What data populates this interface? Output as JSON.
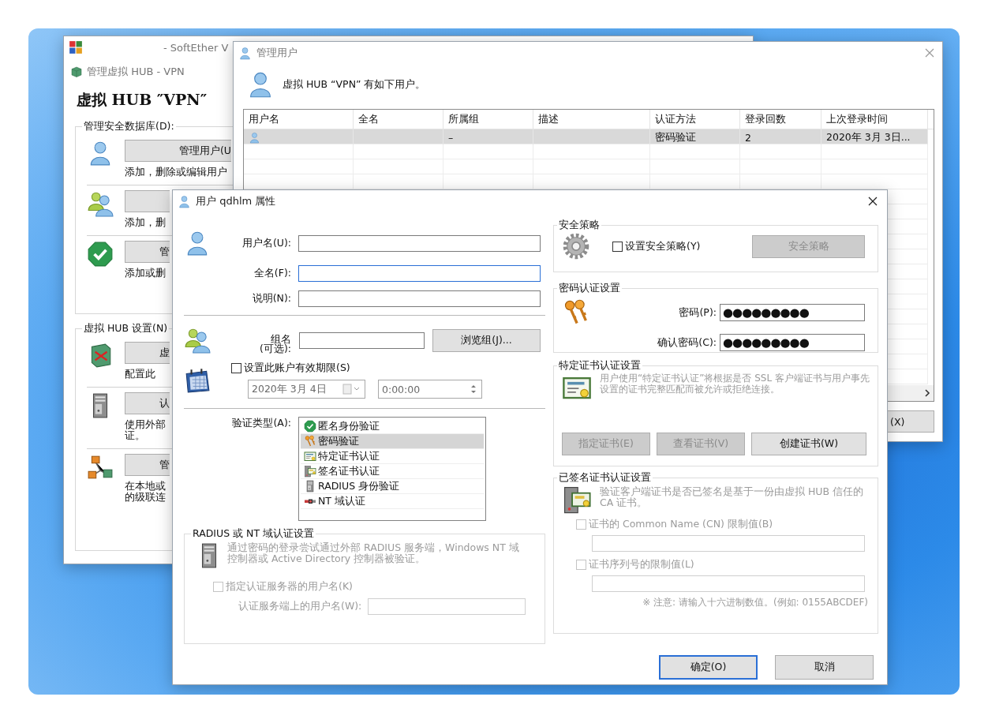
{
  "hub_window": {
    "title": "- SoftEther V",
    "subtitle": "管理虚拟 HUB - VPN",
    "heading": "虚拟 HUB ″VPN″",
    "sections": [
      {
        "title": "管理安全数据库(D):",
        "items": [
          {
            "kind": "user",
            "button": "管理用户(U",
            "note": [
              "添加，删除或编辑用户"
            ]
          },
          {
            "kind": "group",
            "note": [
              "添加，删"
            ]
          },
          {
            "kind": "check",
            "button": "管",
            "note": [
              "添加或删"
            ]
          }
        ]
      },
      {
        "title": "虚拟 HUB 设置(N)",
        "items": [
          {
            "kind": "switch",
            "button": "虚",
            "note": [
              "配置此"
            ]
          },
          {
            "kind": "server",
            "button": "认",
            "note": [
              "使用外部",
              "证。"
            ]
          },
          {
            "kind": "cascade",
            "button": "管",
            "note": [
              "在本地或",
              "的级联连"
            ]
          }
        ]
      }
    ]
  },
  "users_window": {
    "title": "管理用户",
    "message": "虚拟 HUB “VPN” 有如下用户。",
    "columns": [
      "用户名",
      "全名",
      "所属组",
      "描述",
      "认证方法",
      "登录回数",
      "上次登录时间"
    ],
    "rows": [
      {
        "selected": true,
        "group": "–",
        "auth": "密码验证",
        "logins": "2",
        "last_login": "2020年 3月 3日..."
      }
    ],
    "close_button": "(X)"
  },
  "dialog": {
    "title": "用户 qdhlm 属性",
    "fields": [
      {
        "label": "用户名(U):",
        "focused": false
      },
      {
        "label": "全名(F):",
        "focused": true
      },
      {
        "label": "说明(N):",
        "focused": false
      }
    ],
    "group": {
      "label": [
        "组名",
        "(可选):"
      ],
      "button": "浏览组(J)..."
    },
    "expiry": {
      "label": "设置此账户有效期限(S)",
      "checked": false,
      "date": "2020年 3月 4日",
      "time": "0:00:00"
    },
    "auth_type": {
      "label": "验证类型(A):",
      "options": [
        {
          "kind": "check",
          "label": "匿名身份验证",
          "selected": false
        },
        {
          "kind": "keys",
          "label": "密码验证",
          "selected": true
        },
        {
          "kind": "cert",
          "label": "特定证书认证",
          "selected": false
        },
        {
          "kind": "signed",
          "label": "签名证书认证",
          "selected": false
        },
        {
          "kind": "server",
          "label": "RADIUS 身份验证",
          "selected": false
        },
        {
          "kind": "domain",
          "label": "NT 域认证",
          "selected": false
        }
      ]
    },
    "radius": {
      "title": "RADIUS 或 NT 域认证设置",
      "disabled": true,
      "description": "通过密码的登录尝试通过外部 RADIUS 服务端，Windows NT 域控制器或 Active Directory 控制器被验证。",
      "checkbox": {
        "label": "指定认证服务器的用户名(K)",
        "checked": false
      },
      "field_label": "认证服务端上的用户名(W):"
    },
    "security_policy": {
      "title": "安全策略",
      "checkbox": {
        "label": "设置安全策略(Y)",
        "checked": false
      },
      "button": {
        "label": "安全策略",
        "disabled": true
      }
    },
    "password": {
      "title": "密码认证设置",
      "fields": [
        {
          "label": "密码(P):",
          "value": "●●●●●●●●●"
        },
        {
          "label": "确认密码(C):",
          "value": "●●●●●●●●●"
        }
      ]
    },
    "cert_auth": {
      "title": "特定证书认证设置",
      "disabled": true,
      "description": "用户使用“特定证书认证”将根据是否 SSL 客户端证书与用户事先设置的证书完整匹配而被允许或拒绝连接。",
      "buttons": [
        {
          "label": "指定证书(E)",
          "disabled": true
        },
        {
          "label": "查看证书(V)",
          "disabled": true
        },
        {
          "label": "创建证书(W)",
          "disabled": false
        }
      ]
    },
    "signed_cert": {
      "title": "已签名证书认证设置",
      "disabled": true,
      "description": "验证客户端证书是否已签名是基于一份由虚拟 HUB 信任的 CA 证书。",
      "options": [
        {
          "label": "证书的 Common Name (CN) 限制值(B)",
          "checked": false
        },
        {
          "label": "证书序列号的限制值(L)",
          "checked": false
        }
      ],
      "note": "※ 注意: 请输入十六进制数值。(例如: 0155ABCDEF)"
    },
    "buttons": [
      {
        "label": "确定(O)",
        "default": true
      },
      {
        "label": "取消",
        "default": false
      }
    ]
  }
}
